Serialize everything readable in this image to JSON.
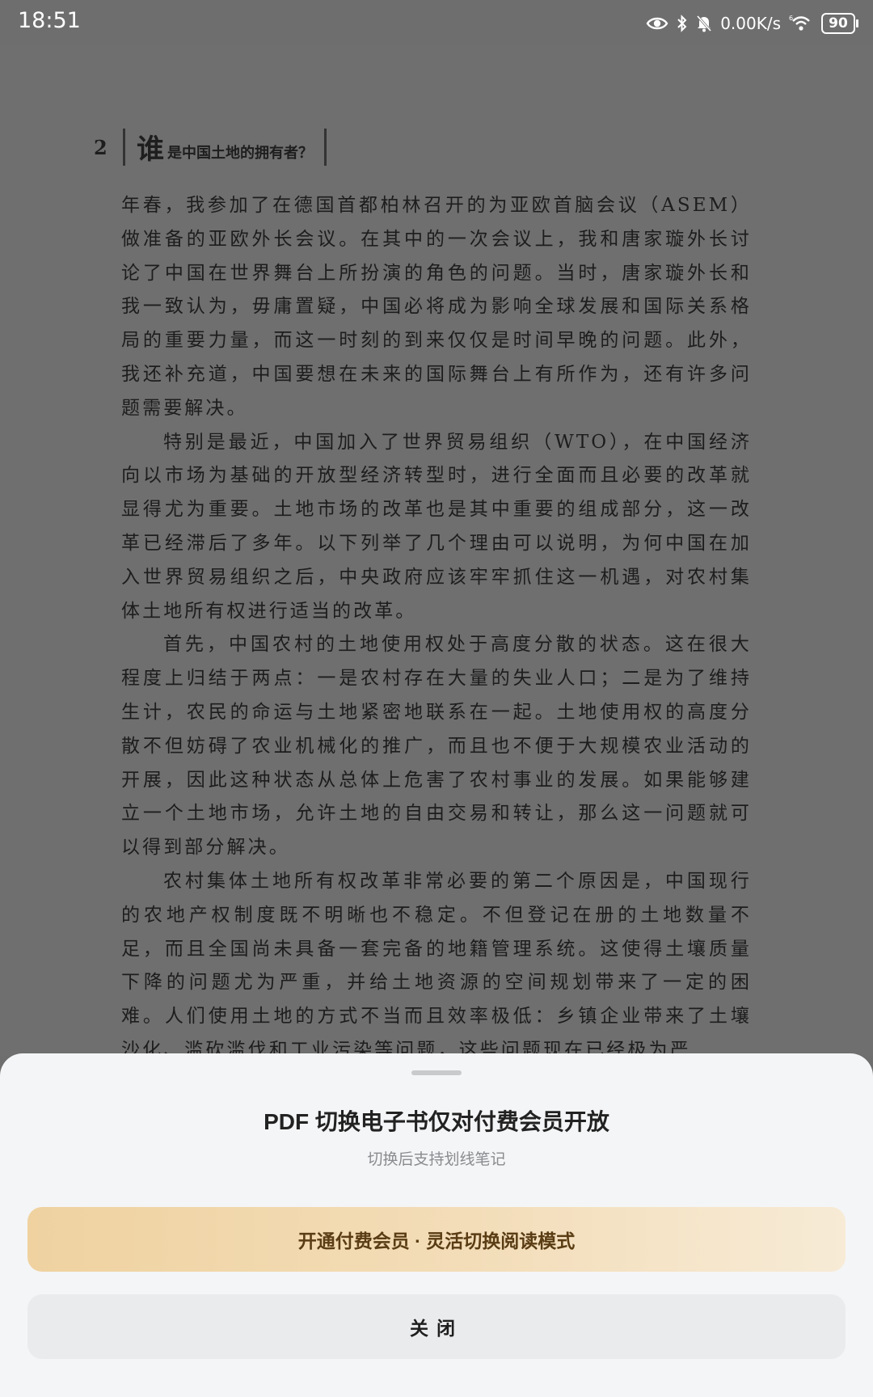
{
  "status_bar": {
    "time": "18:51",
    "net_speed": "0.00K/s",
    "battery": "90",
    "icons": [
      "eye-icon",
      "bluetooth-icon",
      "notifications-off-icon",
      "wifi-6-icon",
      "battery-icon"
    ]
  },
  "page": {
    "number": "2",
    "heading_big": "谁",
    "heading_small": "是中国土地的拥有者？",
    "paragraphs": [
      "年春，我参加了在德国首都柏林召开的为亚欧首脑会议（ASEM）做准备的亚欧外长会议。在其中的一次会议上，我和唐家璇外长讨论了中国在世界舞台上所扮演的角色的问题。当时，唐家璇外长和我一致认为，毋庸置疑，中国必将成为影响全球发展和国际关系格局的重要力量，而这一时刻的到来仅仅是时间早晚的问题。此外，我还补充道，中国要想在未来的国际舞台上有所作为，还有许多问题需要解决。",
      "特别是最近，中国加入了世界贸易组织（WTO），在中国经济向以市场为基础的开放型经济转型时，进行全面而且必要的改革就显得尤为重要。土地市场的改革也是其中重要的组成部分，这一改革已经滞后了多年。以下列举了几个理由可以说明，为何中国在加入世界贸易组织之后，中央政府应该牢牢抓住这一机遇，对农村集体土地所有权进行适当的改革。",
      "首先，中国农村的土地使用权处于高度分散的状态。这在很大程度上归结于两点：一是农村存在大量的失业人口；二是为了维持生计，农民的命运与土地紧密地联系在一起。土地使用权的高度分散不但妨碍了农业机械化的推广，而且也不便于大规模农业活动的开展，因此这种状态从总体上危害了农村事业的发展。如果能够建立一个土地市场，允许土地的自由交易和转让，那么这一问题就可以得到部分解决。",
      "农村集体土地所有权改革非常必要的第二个原因是，中国现行的农地产权制度既不明晰也不稳定。不但登记在册的土地数量不足，而且全国尚未具备一套完备的地籍管理系统。这使得土壤质量下降的问题尤为严重，并给土地资源的空间规划带来了一定的困难。人们使用土地的方式不当而且效率极低：乡镇企业带来了土壤沙化、滥砍滥伐和工业污染等问题，这些问题现在已经极为严"
    ]
  },
  "sheet": {
    "title": "PDF 切换电子书仅对付费会员开放",
    "subtitle": "切换后支持划线笔记",
    "primary_button": "开通付费会员 · 灵活切换阅读模式",
    "close_button": "关闭"
  }
}
